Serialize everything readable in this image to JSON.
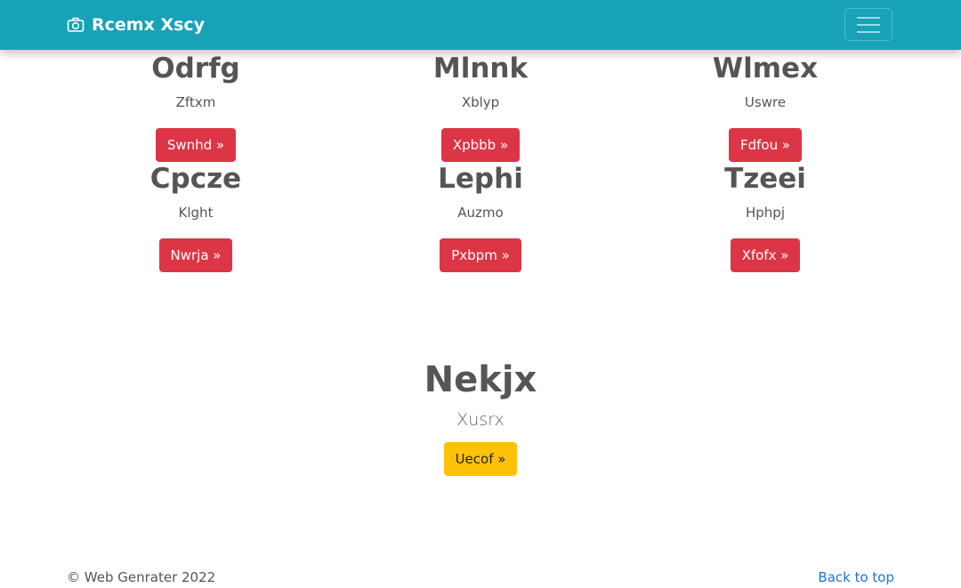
{
  "navbar": {
    "brand": "Rcemx Xscy",
    "brand_icon": "camera-icon",
    "toggler_icon": "hamburger-icon",
    "color": "#17a2b8"
  },
  "cards": [
    {
      "title": "Odrfg",
      "text": "Zftxm",
      "button": "Swnhd »"
    },
    {
      "title": "Mlnnk",
      "text": "Xblyp",
      "button": "Xpbbb »"
    },
    {
      "title": "Wlmex",
      "text": "Uswre",
      "button": "Fdfou »"
    },
    {
      "title": "Cpcze",
      "text": "Klght",
      "button": "Nwrja »"
    },
    {
      "title": "Lephi",
      "text": "Auzmo",
      "button": "Pxbpm »"
    },
    {
      "title": "Tzeei",
      "text": "Hphpj",
      "button": "Xfofx »"
    }
  ],
  "feature": {
    "title": "Nekjx",
    "lead": "Xusrx",
    "button": "Uecof »"
  },
  "footer": {
    "copyright": "© Web Genrater 2022",
    "back_to_top": "Back to top"
  },
  "colors": {
    "danger": "#dc3545",
    "warning": "#ffc107",
    "link": "#1e73d6"
  }
}
